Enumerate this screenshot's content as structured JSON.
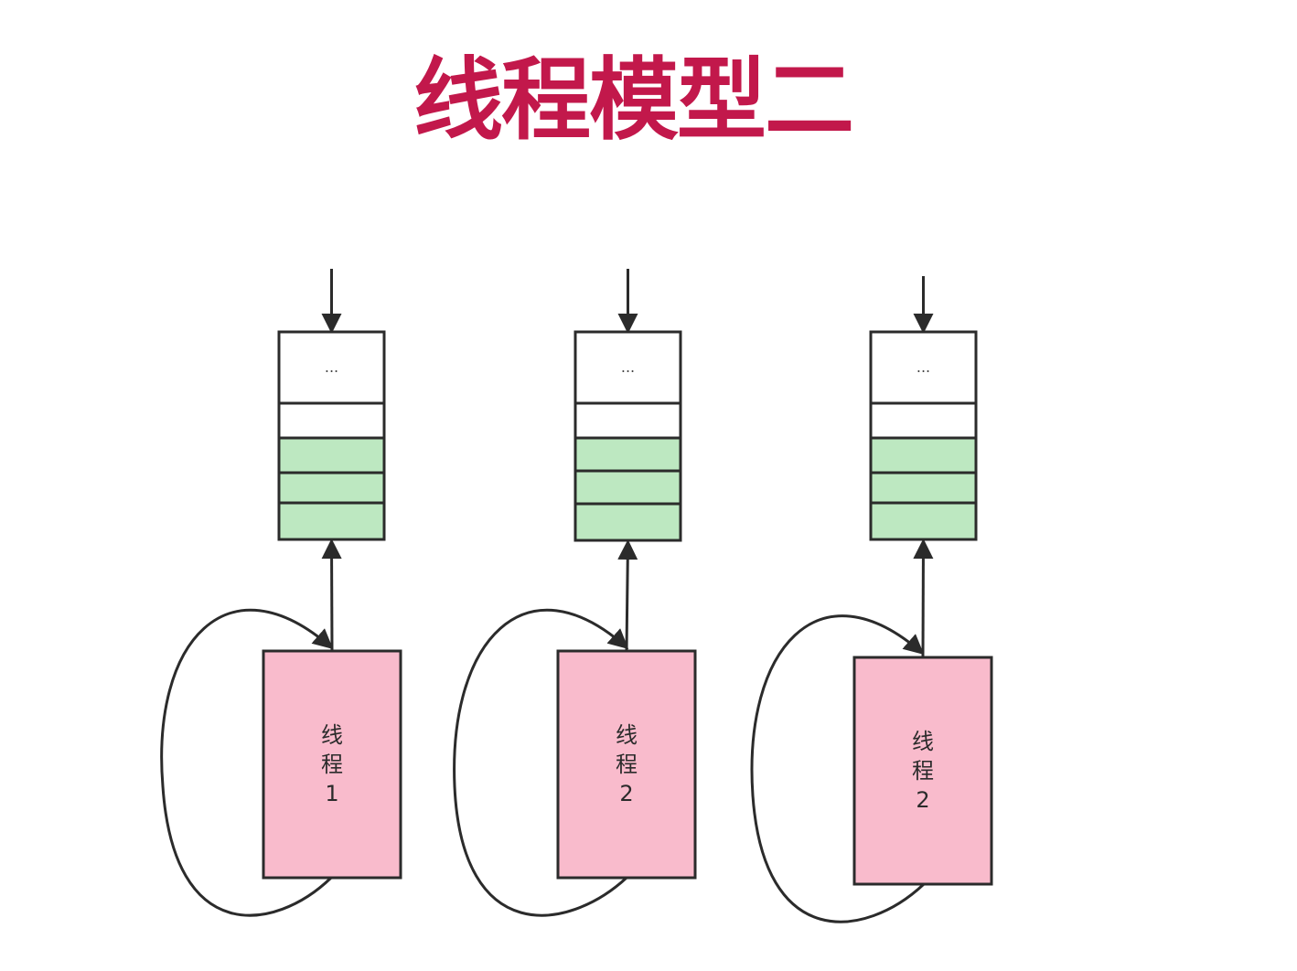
{
  "title": "线程模型二",
  "colors": {
    "title": "#c2184b",
    "queue_empty_slot": "#ffffff",
    "queue_filled_slot": "#bde8c1",
    "thread_box": "#f9bbcc",
    "stroke": "#2b2b2b"
  },
  "queue_slot_text": "...",
  "units": [
    {
      "queue": {
        "slots": [
          "...",
          "",
          "",
          "",
          ""
        ],
        "filled_slots": 3
      },
      "thread": {
        "label_lines": [
          "线",
          "程",
          "1"
        ]
      }
    },
    {
      "queue": {
        "slots": [
          "...",
          "",
          "",
          "",
          ""
        ],
        "filled_slots": 3
      },
      "thread": {
        "label_lines": [
          "线",
          "程",
          "2"
        ]
      }
    },
    {
      "queue": {
        "slots": [
          "...",
          "",
          "",
          "",
          ""
        ],
        "filled_slots": 3
      },
      "thread": {
        "label_lines": [
          "线",
          "程",
          "2"
        ]
      }
    }
  ]
}
